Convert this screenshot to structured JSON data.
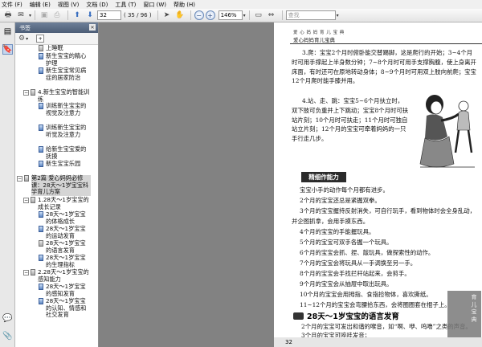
{
  "menu": [
    "文件 (F)",
    "编辑 (E)",
    "视图 (V)",
    "文档 (D)",
    "工具 (T)",
    "窗口 (W)",
    "帮助 (H)"
  ],
  "toolbar": {
    "page_current": "32",
    "page_total": "( 35 / 96 )",
    "zoom": "146%",
    "search_placeholder": "查找"
  },
  "panel": {
    "title": "书签"
  },
  "bookmarks": [
    {
      "text": "上睡眠",
      "indent": 2,
      "expand": "",
      "icon": "gray"
    },
    {
      "text": "新生宝宝的精心护理",
      "indent": 2,
      "expand": "",
      "icon": "blue"
    },
    {
      "text": "新生宝宝常见病症的居家防治",
      "indent": 2,
      "expand": "",
      "icon": "blue"
    },
    {
      "text": "4.新生宝宝的智能训练",
      "indent": 1,
      "expand": "⊟",
      "icon": "gray"
    },
    {
      "text": "训练新生宝宝的视觉及注意力",
      "indent": 2,
      "expand": "",
      "icon": "blue"
    },
    {
      "text": "训练新生宝宝的听觉及注意力",
      "indent": 2,
      "expand": "",
      "icon": "blue"
    },
    {
      "text": "给新生宝宝爱的抚摸",
      "indent": 2,
      "expand": "",
      "icon": "blue"
    },
    {
      "text": "新生宝宝乐园",
      "indent": 2,
      "expand": "",
      "icon": "blue"
    },
    {
      "text": "第2篇 爱心妈妈必修课：28天～1岁宝宝科学育儿方案",
      "indent": 0,
      "expand": "⊟",
      "icon": "gray",
      "selected": true
    },
    {
      "text": "1.28天～1岁宝宝的成长记录",
      "indent": 1,
      "expand": "⊟",
      "icon": "gray"
    },
    {
      "text": "28天～1岁宝宝的体格成长",
      "indent": 2,
      "expand": "",
      "icon": "blue"
    },
    {
      "text": "28天～1岁宝宝的运动发育",
      "indent": 2,
      "expand": "",
      "icon": "blue"
    },
    {
      "text": "28天～1岁宝宝的语言发育",
      "indent": 2,
      "expand": "",
      "icon": "gray"
    },
    {
      "text": "28天～1岁宝宝的生理指标",
      "indent": 2,
      "expand": "",
      "icon": "blue"
    },
    {
      "text": "2.28天～1岁宝宝的感知能力",
      "indent": 1,
      "expand": "⊟",
      "icon": "gray"
    },
    {
      "text": "28天～1岁宝宝的感知发育",
      "indent": 2,
      "expand": "",
      "icon": "blue"
    },
    {
      "text": "28天～1岁宝宝的认知、情感和社交发育",
      "indent": 2,
      "expand": "",
      "icon": "blue"
    }
  ],
  "document": {
    "header_small": "爱 心 妈 妈 育 儿 宝 典",
    "header": "爱心妈妈育儿宝典",
    "para1": "3.爬：宝宝2个月时俯卧能交替踢脚，这是爬行的开始；3~4个月时可用手撑起上半身数分钟；7~8个月时可用手支撑胸腹，使上身离开床面，有时还可在原地转动身体；8~9个月时可用双上肢向前爬；宝宝12个月爬时能手膝并用。",
    "para2": "4.站、走、跳：宝宝5~6个月扶立时，双下肢可负重并上下跳动；宝宝8个月时可扶站片刻；10个月时可扶走；11个月时可独自站立片刻；12个月的宝宝可牵着妈妈的一只手行走几步。",
    "box_heading": "精细作能力",
    "lines": [
      "宝宝小手的动作每个月都有进步。",
      "2个月的宝宝还总是紧握双拳。",
      "3个月的宝宝握持反射消失，可自行玩手，看到物体时会全身乱动，",
      "并企图抓拿，会用手摸东西。",
      "4个月的宝宝的手能握玩具。",
      "5个月的宝宝可双手各握一个玩具。",
      "6个月的宝宝会抓、捏、敲玩具，做探索性的动作。",
      "7个月的宝宝会将玩具从一手调换至另一手。",
      "8个月的宝宝会手找拦杆站起来，会剪手。",
      "9个月的宝宝会从抽屉中取出玩具。",
      "10个月的宝宝会用拇指、食指捡物体，喜欢撕纸。",
      "11~12个月的宝宝会弯腰拾东西，会将圈圈套在棍子上。"
    ],
    "heading2": "28天～1岁宝宝的语言发育",
    "lines2": [
      "2个月的宝宝可发出和谐的喉音，如“啊、咿、呜噜”之类的声音。",
      "3个月的宝宝可啐哇发音；"
    ],
    "page_number": "32",
    "watermark": "育 儿 宝 典"
  }
}
